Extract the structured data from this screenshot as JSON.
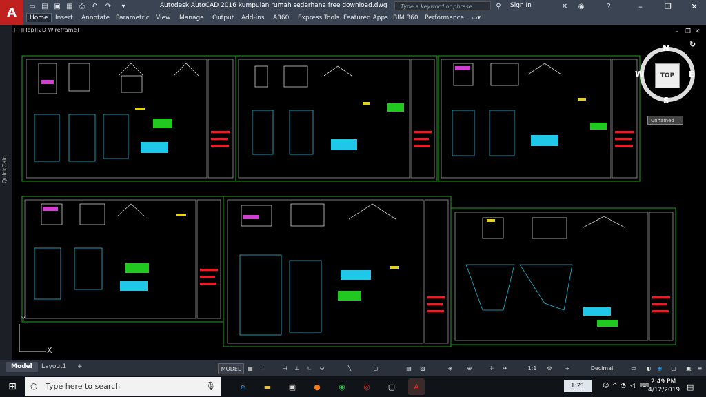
{
  "app": {
    "title": "Autodesk AutoCAD 2016   kumpulan rumah sederhana free download.dwg",
    "logo_letter": "A",
    "search_placeholder": "Type a keyword or phrase",
    "sign_in": "Sign In",
    "help": "?",
    "accent": "#c0211f"
  },
  "ribbon": {
    "tabs": [
      "Home",
      "Insert",
      "Annotate",
      "Parametric",
      "View",
      "Manage",
      "Output",
      "Add-ins",
      "A360",
      "Express Tools",
      "Featured Apps",
      "BIM 360",
      "Performance"
    ]
  },
  "viewport": {
    "label": "[−][Top][2D Wireframe]",
    "quickcalc": "QuickCalc",
    "viewcube": {
      "top": "TOP",
      "n": "N",
      "s": "S",
      "e": "E",
      "w": "W"
    },
    "ucs": "Unnamed",
    "axis_x": "X",
    "axis_y": "Y"
  },
  "layout_tabs": [
    "Model",
    "Layout1",
    "+"
  ],
  "status": {
    "model": "MODEL",
    "scale": "1:1",
    "units": "Decimal"
  },
  "taskbar": {
    "search_placeholder": "Type here to search",
    "time": "2:49 PM",
    "date": "4/12/2019",
    "badge": "1:21"
  }
}
